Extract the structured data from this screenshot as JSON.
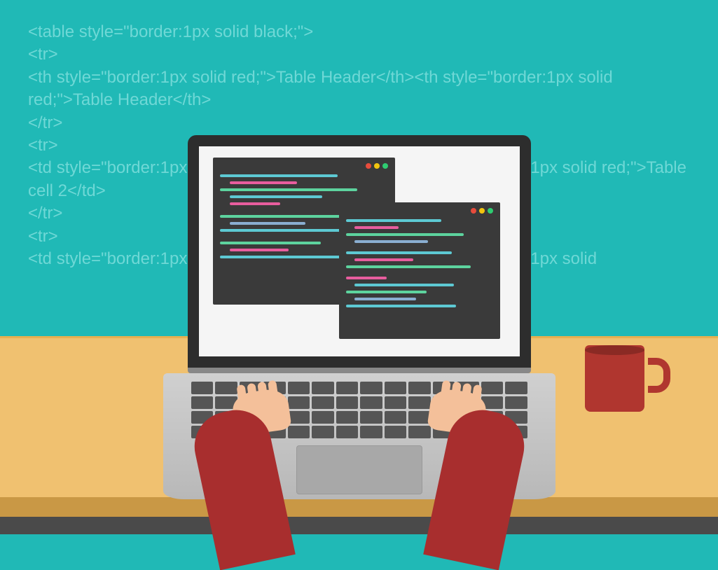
{
  "bg_code": {
    "line1": "<table style=\"border:1px solid black;\">",
    "line2": "<tr>",
    "line3": "<th style=\"border:1px solid red;\">Table Header</th><th style=\"border:1px solid red;\">Table Header</th>",
    "line4": "</tr>",
    "line5": "<tr>",
    "line6": "<td style=\"border:1px solid red;\">Table cell 1</td><td style=\"border:1px solid red;\">Table cell 2</td>",
    "line7": "</tr>",
    "line8": "<tr>",
    "line9": "<td style=\"border:1px solid red;\">Table cell 1</td><td style=\"border:1px solid"
  },
  "visible_fragments": {
    "border1p_left": "<td style=\"border:1p",
    "border_right": "e=\"border:1px solid",
    "cell2_left": "red;\">Table cell 2</td"
  },
  "colors": {
    "background": "#20b9b6",
    "bg_text": "#6fd8d6",
    "desk": "#f0c170",
    "desk_edge": "#c99845",
    "floor": "#4a4a4a",
    "laptop_bezel": "#2d2d2d",
    "laptop_base": "#c8c8c8",
    "editor_bg": "#3a3a3a",
    "mug": "#b0362f",
    "sleeve": "#a82e2e",
    "skin": "#f4c09a",
    "code_green": "#5dd39e",
    "code_pink": "#e85d9e",
    "code_cyan": "#5dc9d3",
    "code_blue": "#8aaed1"
  },
  "icons": {
    "traffic_red": "red",
    "traffic_yellow": "yellow",
    "traffic_green": "green"
  }
}
